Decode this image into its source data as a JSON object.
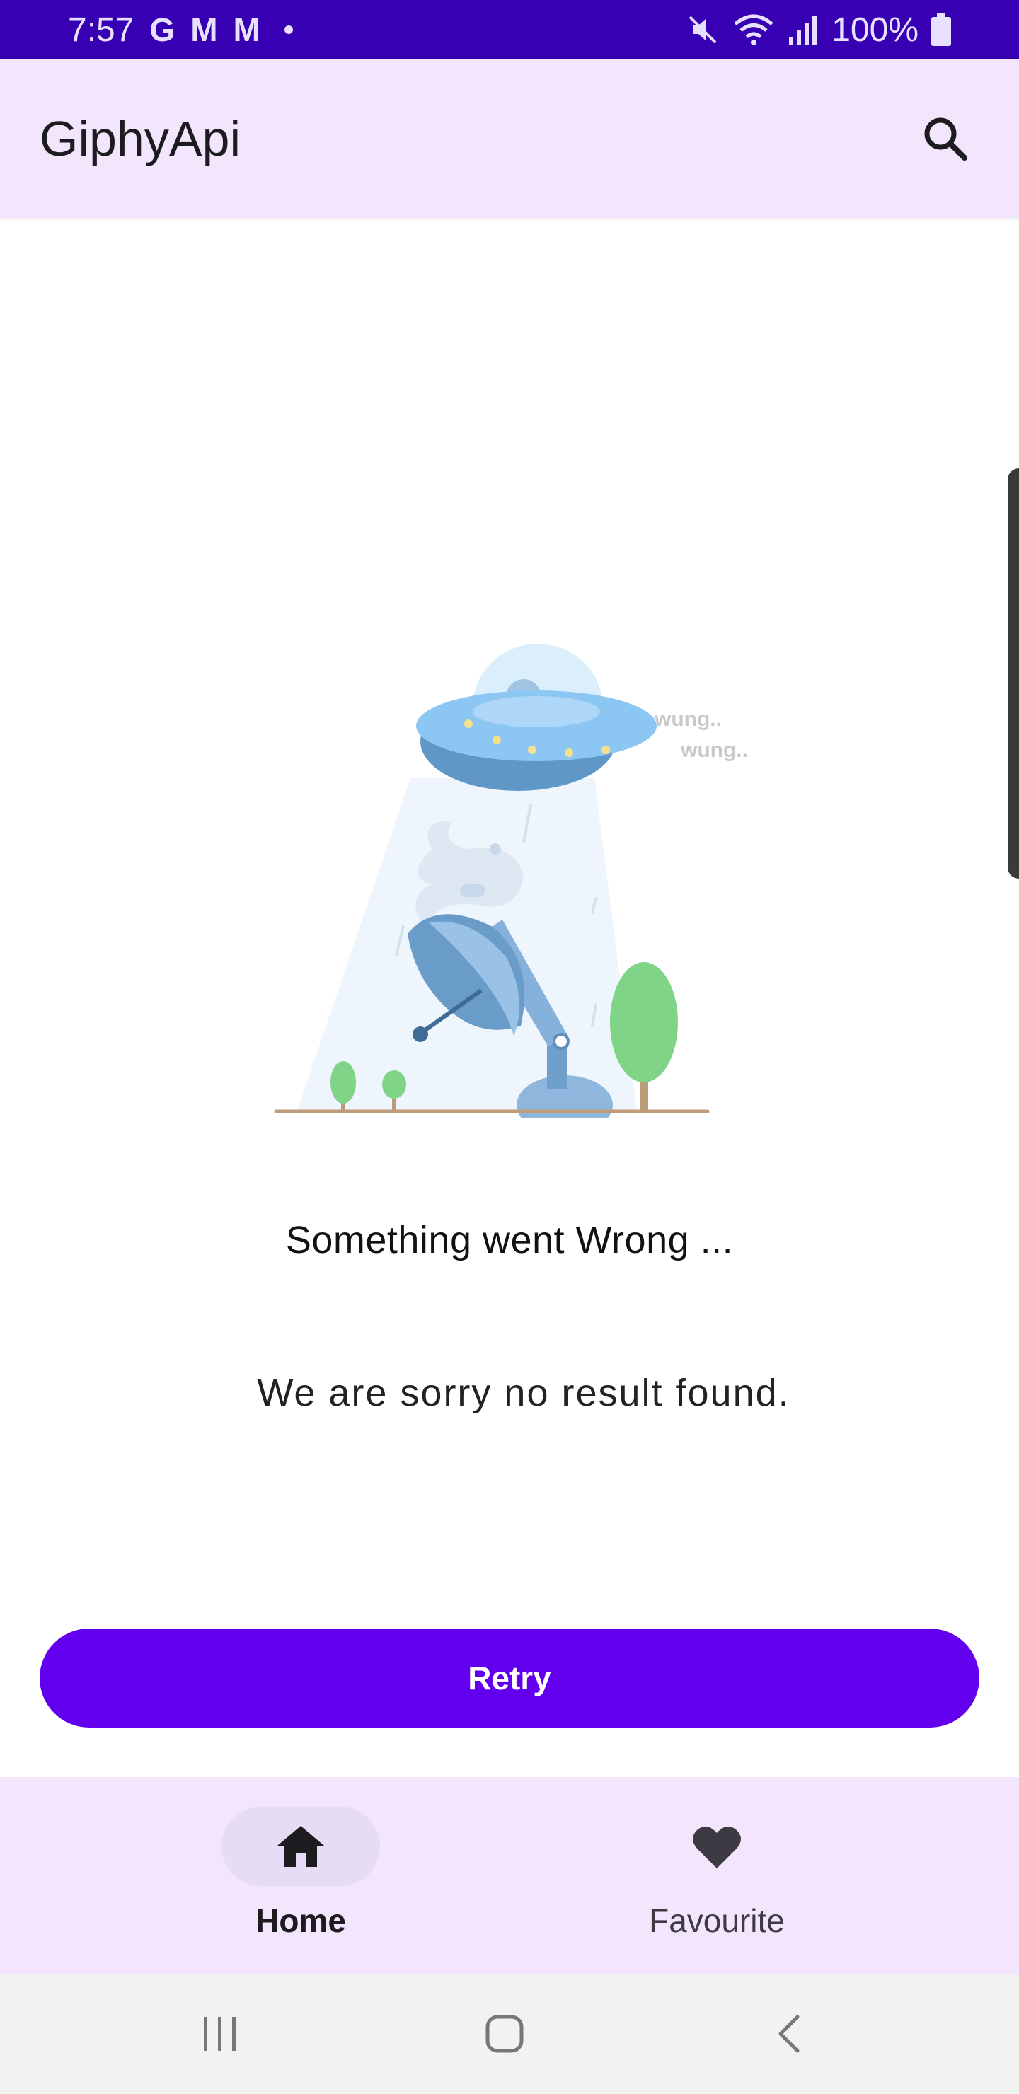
{
  "status_bar": {
    "time": "7:57",
    "notif_icons": [
      "google-icon",
      "gmail-icon",
      "gmail-icon",
      "more-dot"
    ],
    "google_glyph": "G",
    "gmail_glyph": "M",
    "battery": "100%"
  },
  "app_bar": {
    "title": "GiphyApi",
    "search_icon": "search-icon"
  },
  "illustration": {
    "sound_1": "wung..",
    "sound_2": "wung.."
  },
  "error": {
    "title": "Something went Wrong ...",
    "message": "We are sorry no result found."
  },
  "actions": {
    "retry_label": "Retry"
  },
  "bottom_nav": {
    "items": [
      {
        "label": "Home",
        "icon": "home-icon",
        "selected": true
      },
      {
        "label": "Favourite",
        "icon": "heart-icon",
        "selected": false
      }
    ]
  },
  "colors": {
    "status_bar": "#3700b3",
    "app_bar": "#f3e5fb",
    "primary": "#6200ee"
  }
}
